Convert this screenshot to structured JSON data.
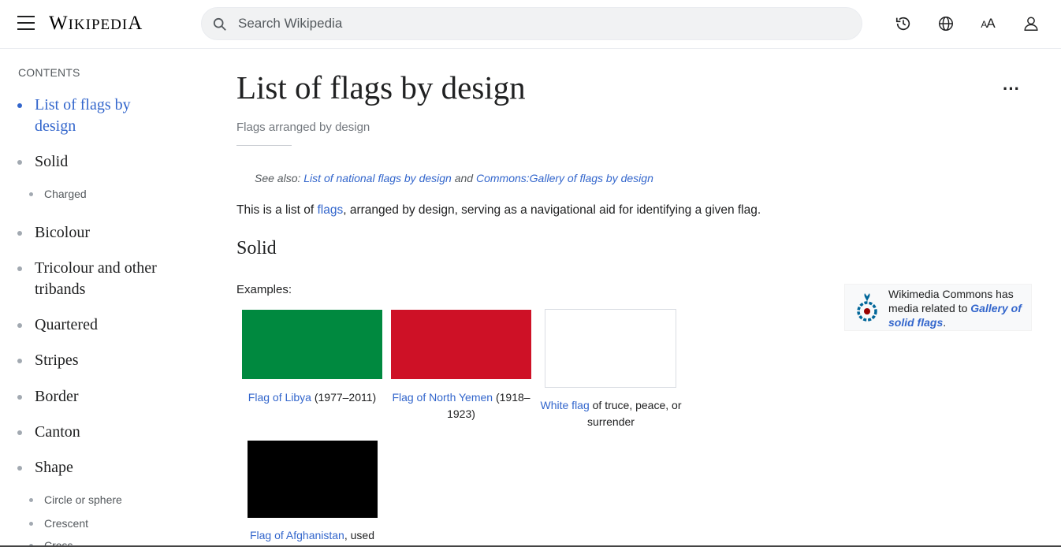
{
  "header": {
    "wordmark": "Wikipedia",
    "search_placeholder": "Search Wikipedia"
  },
  "icons": [
    "menu-icon",
    "search-icon",
    "history-icon",
    "language-icon",
    "text-size-icon",
    "user-icon",
    "more-icon"
  ],
  "toc": {
    "title": "CONTENTS",
    "items": [
      {
        "label": "List of flags by design",
        "active": true
      },
      {
        "label": "Solid"
      },
      {
        "label": "Charged",
        "sub": true
      },
      {
        "label": "Bicolour"
      },
      {
        "label": "Tricolour and other tribands"
      },
      {
        "label": "Quartered"
      },
      {
        "label": "Stripes"
      },
      {
        "label": "Border"
      },
      {
        "label": "Canton"
      },
      {
        "label": "Shape"
      },
      {
        "label": "Circle or sphere",
        "sub": true
      },
      {
        "label": "Crescent",
        "sub": true
      },
      {
        "label": "Cross",
        "sub": true
      }
    ]
  },
  "article": {
    "title": "List of flags by design",
    "tagline": "Flags arranged by design",
    "hatnote": {
      "prefix": "See also: ",
      "link1": "List of national flags by design",
      "middle": " and ",
      "link2": "Commons:Gallery of flags by design"
    },
    "intro": {
      "before": "This is a list of ",
      "link": "flags",
      "after": ", arranged by design, serving as a navigational aid for identifying a given flag."
    },
    "section_solid": "Solid",
    "examples_label": "Examples:",
    "gallery": [
      {
        "link": "Flag of Libya",
        "text": " (1977–2011)",
        "color": "#00893f"
      },
      {
        "link": "Flag of North Yemen",
        "text": " (1918–1923)",
        "color": "#ce1126"
      },
      {
        "link": "White flag",
        "text": " of truce, peace, or surrender",
        "color": "#ffffff"
      },
      {
        "link": "Flag of Afghanistan",
        "text": ", used",
        "color": "#000000"
      }
    ],
    "commons": {
      "text": "Wikimedia Commons has media related to ",
      "link": "Gallery of solid flags",
      "end": "."
    }
  }
}
